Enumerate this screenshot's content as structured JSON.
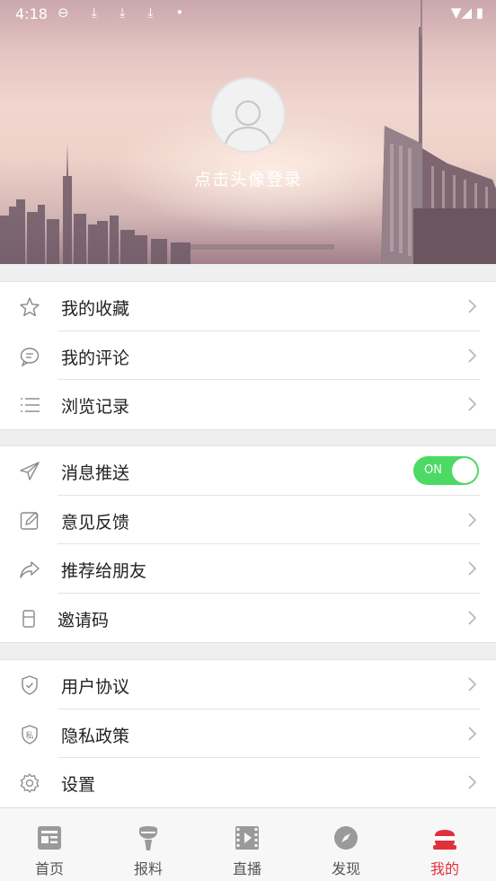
{
  "status_bar": {
    "time": "4:18",
    "icons": "⊖ ⤓ ⤓ ⤓ •",
    "right": "▼◢ ▮"
  },
  "header": {
    "login_label": "点击头像登录"
  },
  "groups": [
    {
      "items": [
        {
          "icon": "star-icon",
          "label": "我的收藏"
        },
        {
          "icon": "comment-icon",
          "label": "我的评论"
        },
        {
          "icon": "list-icon",
          "label": "浏览记录"
        }
      ]
    },
    {
      "items": [
        {
          "icon": "send-icon",
          "label": "消息推送",
          "toggle": "ON"
        },
        {
          "icon": "edit-icon",
          "label": "意见反馈"
        },
        {
          "icon": "share-icon",
          "label": "推荐给朋友"
        },
        {
          "icon": "invite-code-icon",
          "label": "邀请码"
        }
      ]
    },
    {
      "items": [
        {
          "icon": "shield-check-icon",
          "label": "用户协议"
        },
        {
          "icon": "privacy-shield-icon",
          "label": "隐私政策",
          "icon_text": "私"
        },
        {
          "icon": "gear-icon",
          "label": "设置"
        }
      ]
    }
  ],
  "tabs": [
    {
      "label": "首页",
      "icon": "news-icon"
    },
    {
      "label": "报料",
      "icon": "microphone-icon"
    },
    {
      "label": "直播",
      "icon": "video-icon"
    },
    {
      "label": "发现",
      "icon": "compass-icon"
    },
    {
      "label": "我的",
      "icon": "profile-icon",
      "active": true
    }
  ],
  "colors": {
    "accent": "#e0303a",
    "toggle_on": "#4cd964"
  }
}
